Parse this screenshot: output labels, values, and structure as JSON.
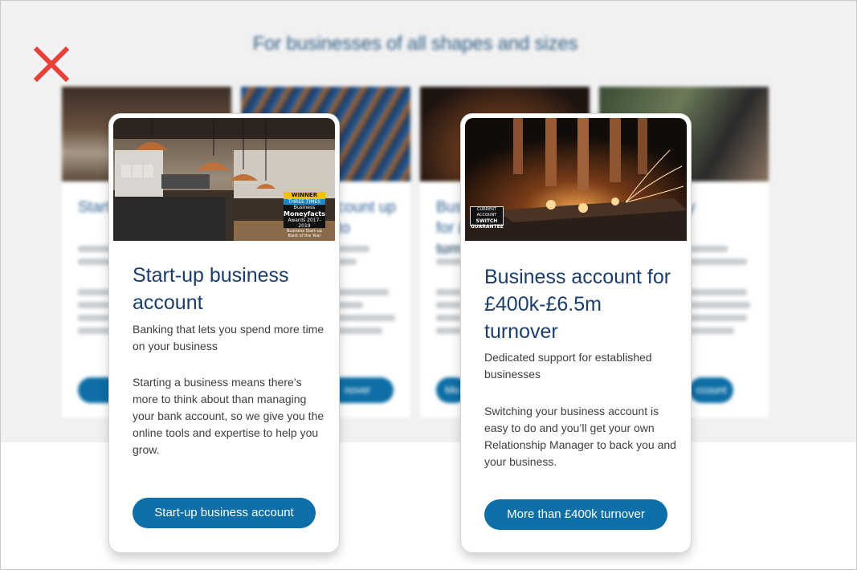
{
  "page": {
    "section_title": "For businesses of all shapes and sizes"
  },
  "close": {
    "icon": "close-icon",
    "color": "#e8423a"
  },
  "background_cards": [
    {
      "title_fragment": "Start accou",
      "button_fragment": "Star"
    },
    {
      "title_fragment": "count up to",
      "button_fragment": "nover"
    },
    {
      "title_fragment": "Busi for £ turn",
      "button_fragment": "Mo"
    },
    {
      "title_fragment": "y",
      "button_fragment": "ccount"
    }
  ],
  "cards": [
    {
      "title": "Start-up business account",
      "subtitle": "Banking that lets you spend more time on your business",
      "body": "Starting a business means there’s more to think about than managing your bank account, so we give you the online tools and expertise to help you grow.",
      "button_label": "Start-up business account",
      "image": "cafe-interior",
      "badge": {
        "line1": "WINNER",
        "line2": "THREE TIMES",
        "line3": "Business",
        "line4": "Moneyfacts",
        "line5": "Awards 2017-2019",
        "line6": "Business Start-up Bank of the Year"
      }
    },
    {
      "title": "Business account for £400k-£6.5m turnover",
      "subtitle": "Dedicated support for established businesses",
      "body": "Switching your business account is easy to do and you’ll get your own Relationship Manager to back you and your business.",
      "button_label": "More than £400k turnover",
      "image": "factory-machinery",
      "badge": {
        "line1": "CURRENT ACCOUNT",
        "line2": "SWITCH",
        "line3": "GUARANTEE"
      }
    }
  ],
  "colors": {
    "primary_button": "#0c6fa8",
    "title_navy": "#1b3d6b",
    "band_grey": "#f1f1f2"
  }
}
